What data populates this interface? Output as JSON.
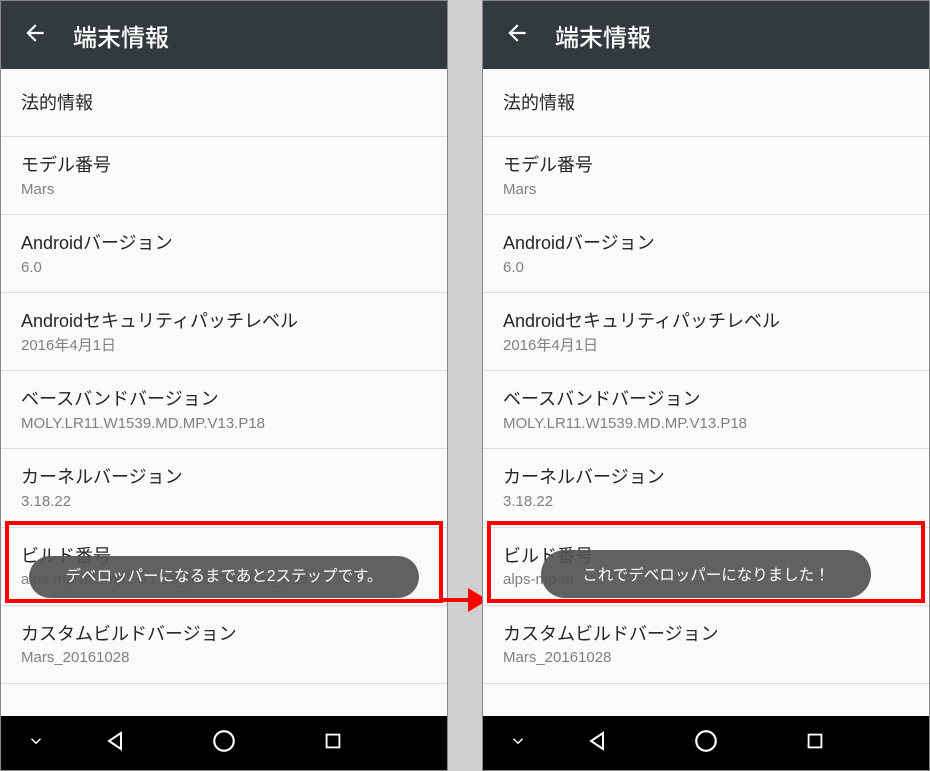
{
  "left": {
    "appbar": {
      "title": "端末情報"
    },
    "items": [
      {
        "title": "法的情報",
        "sub": ""
      },
      {
        "title": "モデル番号",
        "sub": "Mars"
      },
      {
        "title": "Androidバージョン",
        "sub": "6.0"
      },
      {
        "title": "Androidセキュリティパッチレベル",
        "sub": "2016年4月1日"
      },
      {
        "title": "ベースバンドバージョン",
        "sub": "MOLY.LR11.W1539.MD.MP.V13.P18"
      },
      {
        "title": "カーネルバージョン",
        "sub": "3.18.22"
      },
      {
        "title": "ビルド番号",
        "sub": "alps-mp-m0.mp7-V1.18_nb6735.66.m_P16"
      },
      {
        "title": "カスタムビルドバージョン",
        "sub": "Mars_20161028"
      }
    ],
    "toast": "デベロッパーになるまであと2ステップです。"
  },
  "right": {
    "appbar": {
      "title": "端末情報"
    },
    "items": [
      {
        "title": "法的情報",
        "sub": ""
      },
      {
        "title": "モデル番号",
        "sub": "Mars"
      },
      {
        "title": "Androidバージョン",
        "sub": "6.0"
      },
      {
        "title": "Androidセキュリティパッチレベル",
        "sub": "2016年4月1日"
      },
      {
        "title": "ベースバンドバージョン",
        "sub": "MOLY.LR11.W1539.MD.MP.V13.P18"
      },
      {
        "title": "カーネルバージョン",
        "sub": "3.18.22"
      },
      {
        "title": "ビルド番号",
        "sub": "alps-mp-m"
      },
      {
        "title": "カスタムビルドバージョン",
        "sub": "Mars_20161028"
      }
    ],
    "toast": "これでデベロッパーになりました！"
  }
}
